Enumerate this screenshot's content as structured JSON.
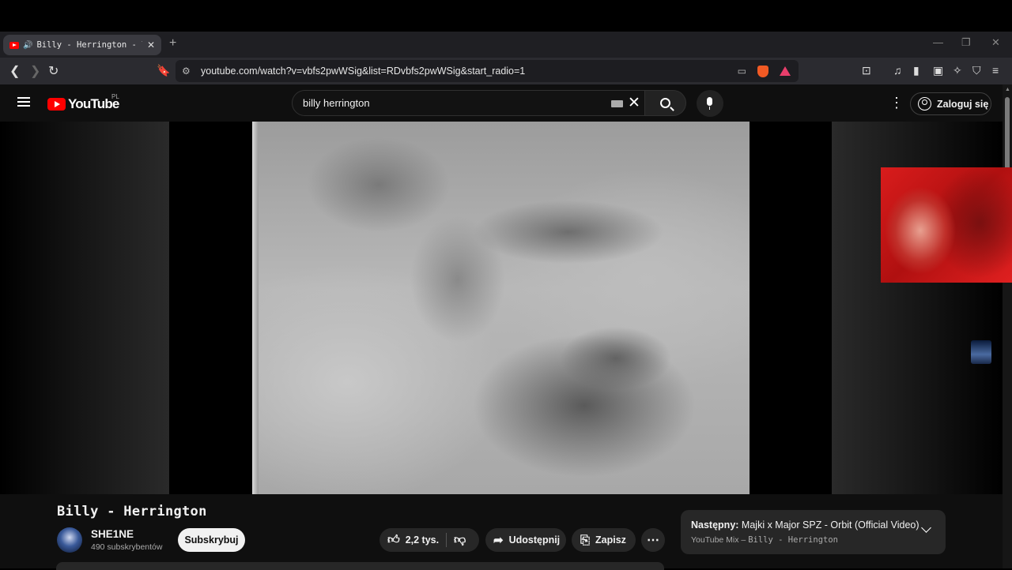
{
  "browser": {
    "tab_title": "Billy - Herrington - YouTube",
    "tab_close": "✕",
    "new_tab": "+",
    "url": "youtube.com/watch?v=vbfs2pwWSig&list=RDvbfs2pwWSig&start_radio=1",
    "window_controls": [
      "—",
      "❐",
      "✕"
    ]
  },
  "youtube": {
    "logo_text": "YouTube",
    "country_code": "PL",
    "search_value": "billy herrington",
    "signin_label": "Zaloguj się"
  },
  "video": {
    "title": "Billy - Herrington",
    "channel_name": "SHE1NE",
    "subscribers": "490 subskrybentów",
    "subscribe_label": "Subskrybuj",
    "likes": "2,2 tys.",
    "share_label": "Udostępnij",
    "save_label": "Zapisz"
  },
  "up_next": {
    "prefix": "Następny:",
    "title": "Majki x Major SPZ - Orbit (Official Video)",
    "mix_label": "YouTube Mix –",
    "mix_name": "Billy - Herrington"
  },
  "icons": {
    "tab_favicon": "youtube-favicon-icon",
    "audio": "speaker-icon",
    "like": "thumbs-up-icon",
    "dislike": "thumbs-down-icon",
    "share": "share-arrow-icon",
    "save": "bookmark-icon",
    "more": "more-horizontal-icon"
  },
  "colors": {
    "yt_red": "#ff0000",
    "background": "#0f0f0f",
    "pill": "#272727",
    "brave_orange": "#f15a24"
  }
}
